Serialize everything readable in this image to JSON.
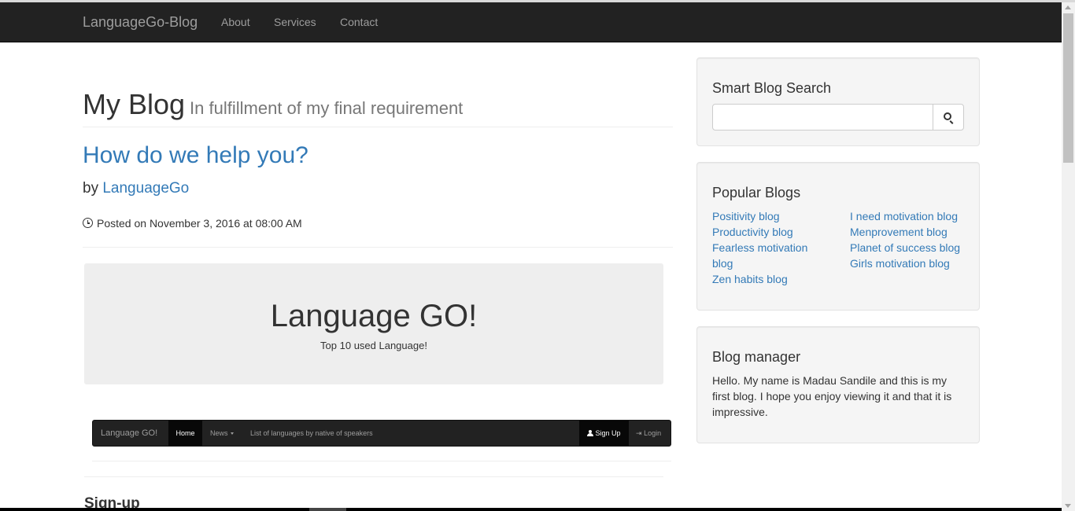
{
  "navbar": {
    "brand": "LanguageGo-Blog",
    "links": [
      "About",
      "Services",
      "Contact"
    ]
  },
  "header": {
    "title": "My Blog",
    "subtitle": "In fulfillment of my final requirement"
  },
  "post": {
    "title": "How do we help you?",
    "by_prefix": "by",
    "author": "LanguageGo",
    "posted": "Posted on November 3, 2016 at 08:00 AM"
  },
  "jumbotron": {
    "title": "Language GO!",
    "subtitle": "Top 10 used Language!"
  },
  "mini_nav": {
    "brand": "Language GO!",
    "home": "Home",
    "news": "News",
    "list": "List of languages by native of speakers",
    "signup": "Sign Up",
    "login": "Login"
  },
  "signup_heading": "Sign-up",
  "sidebar": {
    "search": {
      "title": "Smart Blog Search",
      "value": ""
    },
    "popular": {
      "title": "Popular Blogs",
      "left": [
        "Positivity blog",
        "Productivity blog",
        "Fearless motivation",
        "blog",
        "Zen habits blog"
      ],
      "right": [
        "I need motivation blog",
        "Menprovement blog",
        "Planet of success blog",
        "Girls motivation blog"
      ]
    },
    "manager": {
      "title": "Blog manager",
      "text": "Hello. My name is Madau Sandile and this is my first blog. I hope you enjoy viewing it and that it is impressive."
    }
  },
  "colors": {
    "navbar_bg": "#222222",
    "link": "#337ab7",
    "well_bg": "#f5f5f5"
  }
}
